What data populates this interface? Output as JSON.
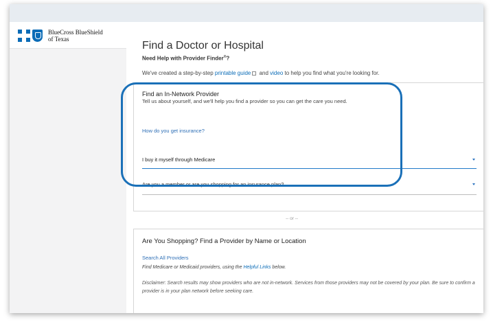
{
  "header": {
    "logo_line1": "BlueCross BlueShield",
    "logo_line2": "of Texas"
  },
  "page": {
    "title": "Find a Doctor or Hospital",
    "help_text": "Need Help with Provider Finder",
    "help_sup": "®",
    "help_suffix": "?",
    "intro_prefix": "We've created a step-by-step ",
    "intro_link1": "printable guide",
    "intro_icon": "external-link-icon",
    "intro_mid": " and ",
    "intro_link2": "video",
    "intro_suffix": " to help you find what you're looking for."
  },
  "in_network": {
    "title": "Find an In-Network Provider",
    "subtitle": "Tell us about yourself, and we'll help you find a provider so you can get the care you need.",
    "question_label": "How do you get insurance?",
    "selected_value": "I buy it myself through Medicare",
    "member_select": "Are you a member or are you shopping for an insurance plan?"
  },
  "separator": "-- or --",
  "shopping": {
    "title": "Are You Shopping? Find a Provider by Name or Location",
    "search_all": "Search All Providers",
    "find_prefix": "Find Medicare or Medicaid providers, using the ",
    "find_link": "Helpful Links",
    "find_suffix": " below.",
    "disclaimer": "Disclaimer: Search results may show providers who are not in-network. Services from those providers may not be covered by your plan. Be sure to confirm a provider is in your plan network before seeking care."
  },
  "colors": {
    "brand_blue": "#0b6cb7",
    "highlight_ring": "#1a70b8",
    "link": "#2e6fb6"
  }
}
